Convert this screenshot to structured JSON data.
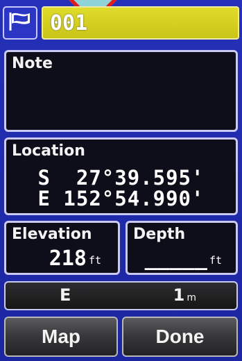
{
  "waypoint": {
    "name": "001",
    "icon": "flag-icon"
  },
  "note": {
    "label": "Note",
    "text": ""
  },
  "location": {
    "label": "Location",
    "lat": "S  27°39.595'",
    "lon": "E 152°54.990'"
  },
  "elevation": {
    "label": "Elevation",
    "value": "218",
    "unit": "ft"
  },
  "depth": {
    "label": "Depth",
    "value": "_____",
    "unit": "ft"
  },
  "bearing": {
    "direction": "E",
    "distance": "1",
    "distance_unit": "m"
  },
  "buttons": {
    "map": "Map",
    "done": "Done"
  },
  "colors": {
    "background": "#1f2aa8",
    "name_field": "#e0dc2a",
    "panel": "#0e0e1a",
    "pointer_fill": "#8ed3d8",
    "pointer_border": "#e41a1a"
  }
}
